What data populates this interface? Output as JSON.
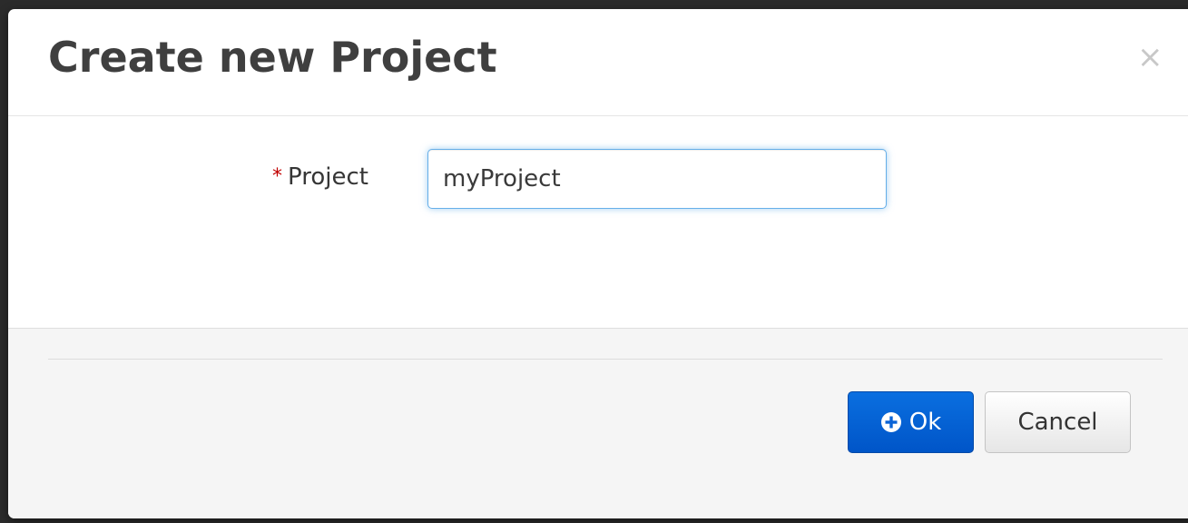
{
  "dialog": {
    "title": "Create new Project",
    "close_label": "×"
  },
  "form": {
    "required_marker": "*",
    "project_label": "Project",
    "project_value": "myProject"
  },
  "footer": {
    "ok_label": "Ok",
    "cancel_label": "Cancel"
  },
  "colors": {
    "primary_button": "#0a6fe0",
    "required_marker": "#c00000",
    "focus_border": "#66afe9"
  }
}
